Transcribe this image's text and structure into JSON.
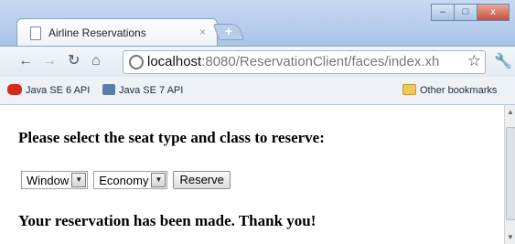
{
  "browser": {
    "tab_title": "Airline Reservations",
    "tab_close": "×",
    "new_tab": "+",
    "url_host": "localhost",
    "url_rest": ":8080/ReservationClient/faces/index.xh",
    "window_buttons": {
      "minimize": "–",
      "maximize": "□",
      "close": "x"
    }
  },
  "bookmarks": [
    {
      "label": "Java SE 6 API",
      "icon": "java-icon"
    },
    {
      "label": "Java SE 7 API",
      "icon": "sun-icon"
    }
  ],
  "other_bookmarks": "Other bookmarks",
  "page": {
    "heading": "Please select the seat type and class to reserve:",
    "seat_type": {
      "selected": "Window"
    },
    "seat_class": {
      "selected": "Economy"
    },
    "reserve_button": "Reserve",
    "confirmation": "Your reservation has been made. Thank you!"
  }
}
